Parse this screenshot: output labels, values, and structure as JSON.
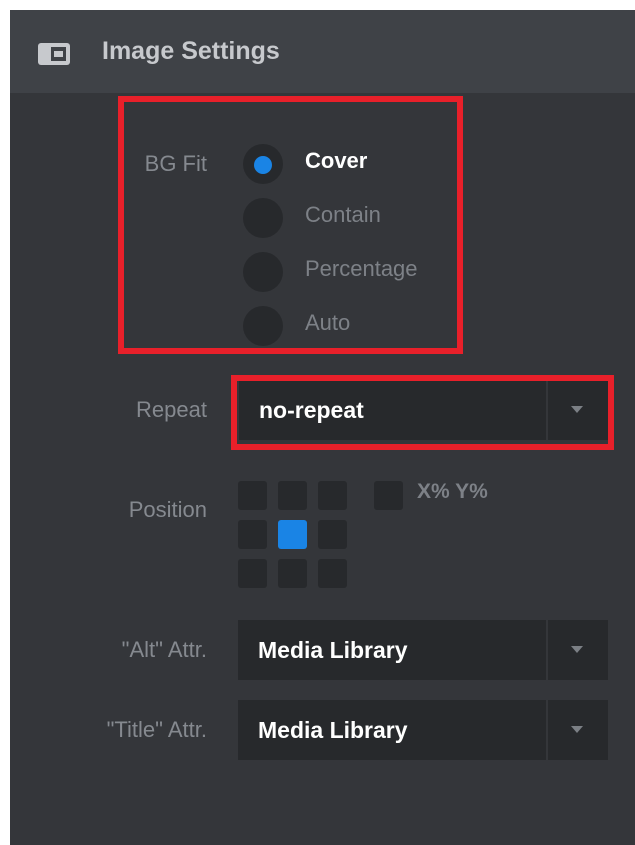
{
  "header": {
    "icon": "panel-layout-icon",
    "title": "Image Settings"
  },
  "bg_fit": {
    "label": "BG Fit",
    "options": [
      {
        "label": "Cover",
        "selected": true
      },
      {
        "label": "Contain",
        "selected": false
      },
      {
        "label": "Percentage",
        "selected": false
      },
      {
        "label": "Auto",
        "selected": false
      }
    ]
  },
  "repeat": {
    "label": "Repeat",
    "value": "no-repeat"
  },
  "position": {
    "label": "Position",
    "selected": "center",
    "custom_label": "X% Y%"
  },
  "alt_attr": {
    "label": "\"Alt\" Attr.",
    "value": "Media Library"
  },
  "title_attr": {
    "label": "\"Title\" Attr.",
    "value": "Media Library"
  },
  "colors": {
    "panel_bg": "#34363a",
    "header_bg": "#3f4247",
    "control_bg": "#27292c",
    "accent": "#1a84e5",
    "highlight": "#e8202a"
  }
}
